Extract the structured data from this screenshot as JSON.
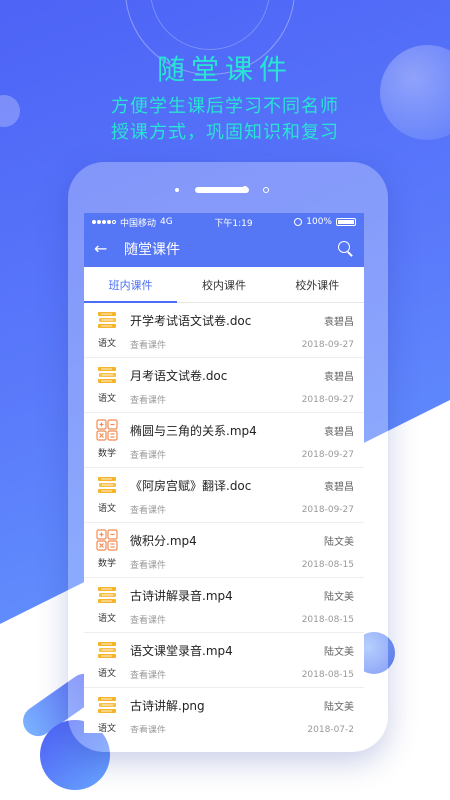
{
  "promo": {
    "headline": "随堂课件",
    "subline1": "方便学生课后学习不同名师",
    "subline2": "授课方式，巩固知识和复习"
  },
  "statusbar": {
    "carrier": "中国移动",
    "network": "4G",
    "time": "下午1:19",
    "battery": "100%"
  },
  "navbar": {
    "title": "随堂课件",
    "back_icon": "back-arrow-icon",
    "search_icon": "search-icon"
  },
  "tabs": [
    {
      "label": "班内课件",
      "active": true
    },
    {
      "label": "校内课件",
      "active": false
    },
    {
      "label": "校外课件",
      "active": false
    }
  ],
  "items": [
    {
      "subject": "语文",
      "icon": "books-icon",
      "name": "开学考试语文试卷.doc",
      "author": "袁碧昌",
      "action": "查看课件",
      "date": "2018-09-27"
    },
    {
      "subject": "语文",
      "icon": "books-icon",
      "name": "月考语文试卷.doc",
      "author": "袁碧昌",
      "action": "查看课件",
      "date": "2018-09-27"
    },
    {
      "subject": "数学",
      "icon": "math-icon",
      "name": "椭圆与三角的关系.mp4",
      "author": "袁碧昌",
      "action": "查看课件",
      "date": "2018-09-27"
    },
    {
      "subject": "语文",
      "icon": "books-icon",
      "name": "《阿房宫赋》翻译.doc",
      "author": "袁碧昌",
      "action": "查看课件",
      "date": "2018-09-27"
    },
    {
      "subject": "数学",
      "icon": "math-icon",
      "name": "微积分.mp4",
      "author": "陆文美",
      "action": "查看课件",
      "date": "2018-08-15"
    },
    {
      "subject": "语文",
      "icon": "books-icon",
      "name": "古诗讲解录音.mp4",
      "author": "陆文美",
      "action": "查看课件",
      "date": "2018-08-15"
    },
    {
      "subject": "语文",
      "icon": "books-icon",
      "name": "语文课堂录音.mp4",
      "author": "陆文美",
      "action": "查看课件",
      "date": "2018-08-15"
    },
    {
      "subject": "语文",
      "icon": "books-icon",
      "name": "古诗讲解.png",
      "author": "陆文美",
      "action": "查看课件",
      "date": "2018-07-2"
    }
  ],
  "colors": {
    "accent": "#5677f5",
    "headline": "#29e3d3",
    "books_icon": "#f5b42a",
    "math_icon": "#f28b50"
  }
}
